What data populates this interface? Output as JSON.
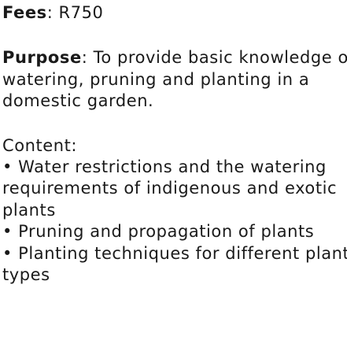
{
  "fees": {
    "label": "Fees",
    "separator": ": ",
    "value": "R750"
  },
  "purpose": {
    "label": "Purpose",
    "separator": ": ",
    "lines": [
      "To provide basic knowledge of",
      "watering, pruning and planting in a",
      "domestic garden."
    ]
  },
  "content": {
    "heading": "Content:",
    "bullet": "•",
    "items": [
      {
        "lines": [
          "Water restrictions and the watering",
          "requirements of indigenous and exotic",
          "plants"
        ]
      },
      {
        "lines": [
          "Pruning and propagation of plants"
        ]
      },
      {
        "lines": [
          "Planting techniques for different plant",
          "types"
        ]
      }
    ]
  }
}
